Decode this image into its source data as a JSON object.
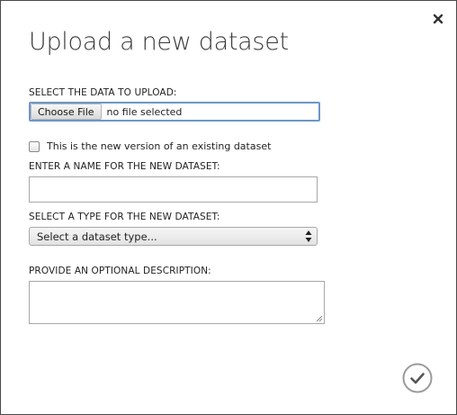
{
  "dialog": {
    "title": "Upload a new dataset",
    "close_icon": "close-icon",
    "ok_icon": "checkmark-circle-icon"
  },
  "upload": {
    "label": "SELECT THE DATA TO UPLOAD:",
    "choose_file_label": "Choose File",
    "file_status": "no file selected"
  },
  "new_version": {
    "label": "This is the new version of an existing dataset",
    "checked": false
  },
  "name": {
    "label": "ENTER A NAME FOR THE NEW DATASET:",
    "value": ""
  },
  "type": {
    "label": "SELECT A TYPE FOR THE NEW DATASET:",
    "selected": "Select a dataset type..."
  },
  "description": {
    "label": "PROVIDE AN OPTIONAL DESCRIPTION:",
    "value": ""
  },
  "colors": {
    "focus_border": "#6b97c9",
    "title_text": "#3a3a3a",
    "button_circle": "#9a9a9a"
  }
}
